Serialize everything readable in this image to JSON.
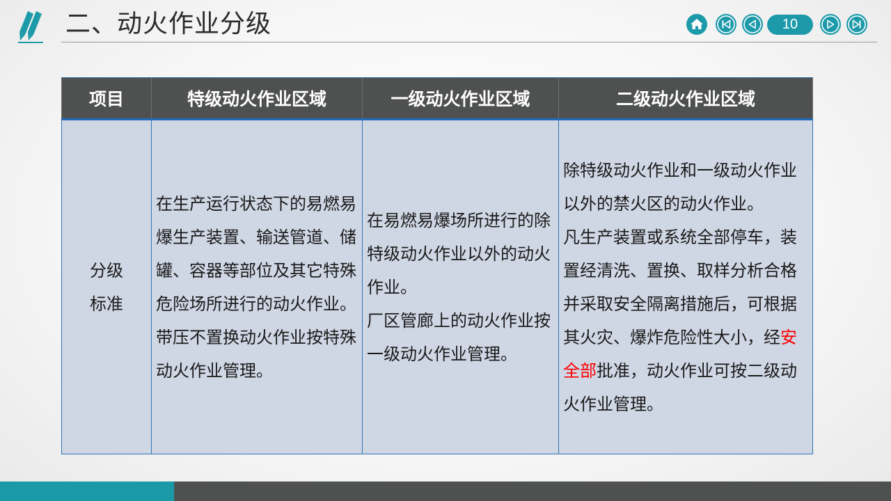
{
  "header": {
    "title": "二、动火作业分级",
    "page_number": "10"
  },
  "colors": {
    "accent": "#1d9aaa",
    "header_bg": "#4f5150",
    "cell_bg": "#cfd6e4",
    "highlight": "#ff0000"
  },
  "table": {
    "headers": [
      "项目",
      "特级动火作业区域",
      "一级动火作业区域",
      "二级动火作业区域"
    ],
    "row_label": [
      "分级",
      "标准"
    ],
    "special": [
      "在生产运行状态下的易燃易爆生产装置、输送管道、储罐、容器等部位及其它特殊危险场所进行的动火作业。",
      "带压不置换动火作业按特殊动火作业管理。"
    ],
    "first": [
      "在易燃易爆场所进行的除特级动火作业以外的动火作业。",
      "厂区管廊上的动火作业按一级动火作业管理。"
    ],
    "second": {
      "p1": "除特级动火作业和一级动火作业以外的禁火区的动火作业。",
      "p2_before": "凡生产装置或系统全部停车，装置经清洗、置换、取样分析合格并采取安全隔离措施后，可根据其火灾、爆炸危险性大小，经",
      "p2_highlight": "安全部",
      "p2_after": "批准，动火作业可按二级动火作业管理。"
    }
  }
}
